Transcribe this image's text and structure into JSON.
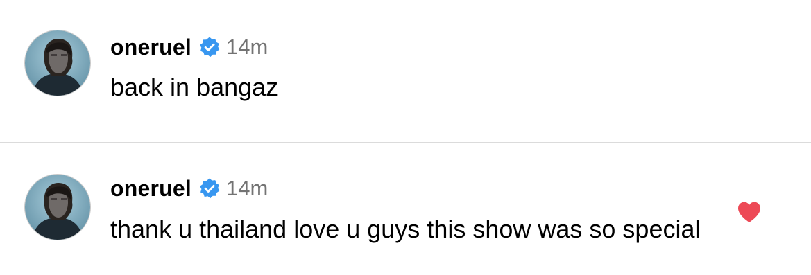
{
  "posts": [
    {
      "username": "oneruel",
      "verified": true,
      "time": "14m",
      "text": "back in bangaz",
      "liked": false
    },
    {
      "username": "oneruel",
      "verified": true,
      "time": "14m",
      "text": "thank u thailand love u guys this show was so special",
      "liked": true
    }
  ],
  "icons": {
    "verified_badge": "verified-badge-icon",
    "like": "heart-icon"
  },
  "colors": {
    "verified_blue": "#3897f0",
    "like_red": "#ed4956",
    "timestamp_gray": "#737373"
  }
}
